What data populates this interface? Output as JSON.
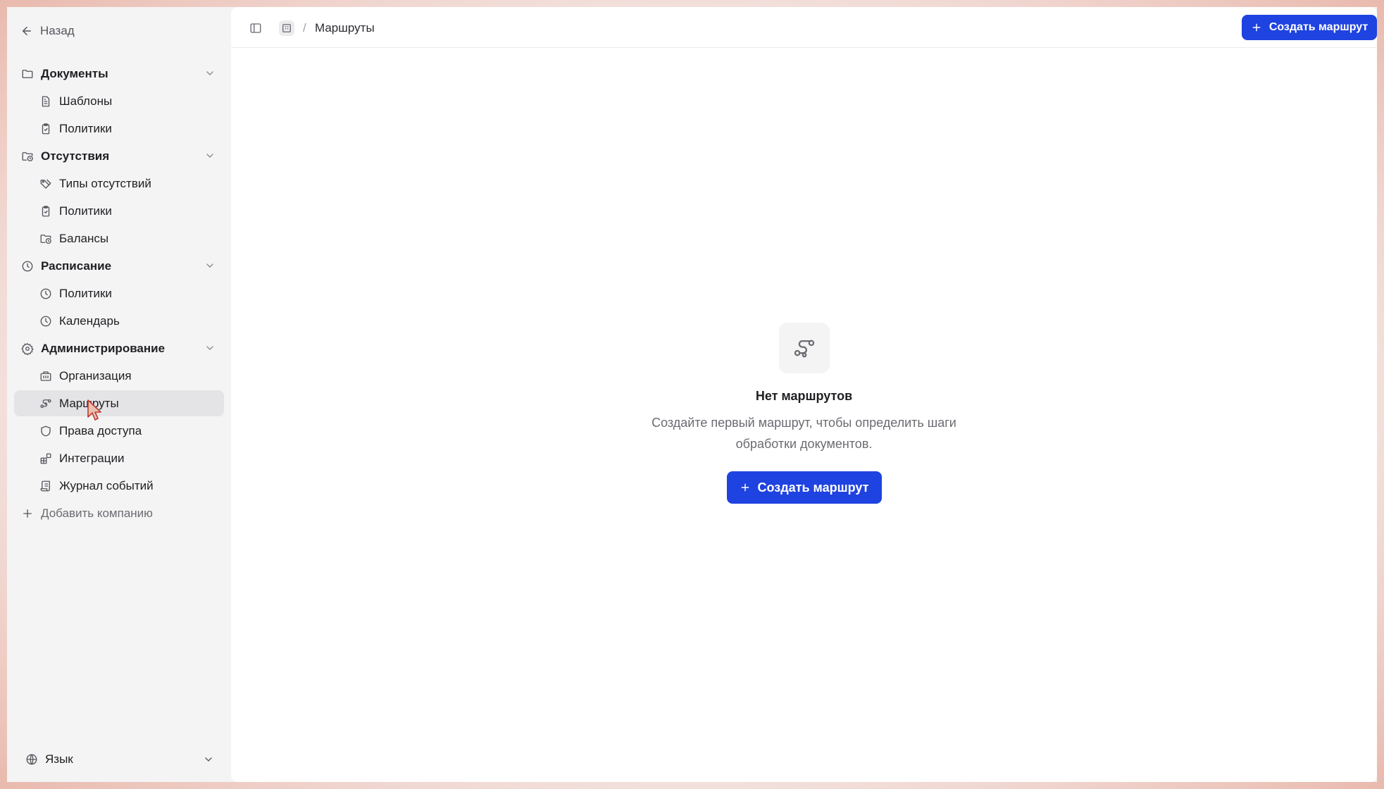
{
  "sidebar": {
    "back_label": "Назад",
    "sections": [
      {
        "label": "Документы",
        "icon": "folder-icon",
        "items": [
          {
            "label": "Шаблоны",
            "icon": "file-text-icon"
          },
          {
            "label": "Политики",
            "icon": "clipboard-check-icon"
          }
        ]
      },
      {
        "label": "Отсутствия",
        "icon": "folder-clock-icon",
        "items": [
          {
            "label": "Типы отсутствий",
            "icon": "tags-icon"
          },
          {
            "label": "Политики",
            "icon": "clipboard-check-icon"
          },
          {
            "label": "Балансы",
            "icon": "folder-clock-icon"
          }
        ]
      },
      {
        "label": "Расписание",
        "icon": "clock-icon",
        "items": [
          {
            "label": "Политики",
            "icon": "clock-icon"
          },
          {
            "label": "Календарь",
            "icon": "clock-icon"
          }
        ]
      },
      {
        "label": "Администрирование",
        "icon": "gear-icon",
        "items": [
          {
            "label": "Организация",
            "icon": "building-icon"
          },
          {
            "label": "Маршруты",
            "icon": "route-icon",
            "active": true
          },
          {
            "label": "Права доступа",
            "icon": "shield-icon"
          },
          {
            "label": "Интеграции",
            "icon": "blocks-icon"
          },
          {
            "label": "Журнал событий",
            "icon": "scroll-icon"
          }
        ]
      }
    ],
    "add_company_label": "Добавить компанию",
    "language_label": "Язык"
  },
  "header": {
    "breadcrumb_separator": "/",
    "breadcrumb_current": "Маршруты",
    "create_button_label": "Создать маршрут"
  },
  "empty_state": {
    "icon": "route-icon",
    "title": "Нет маршрутов",
    "description": "Создайте первый маршрут, чтобы определить шаги обработки документов.",
    "button_label": "Создать маршрут"
  },
  "colors": {
    "accent": "#1f43e0",
    "sidebar_bg": "#f4f4f5",
    "active_item_bg": "#e4e4e7"
  }
}
